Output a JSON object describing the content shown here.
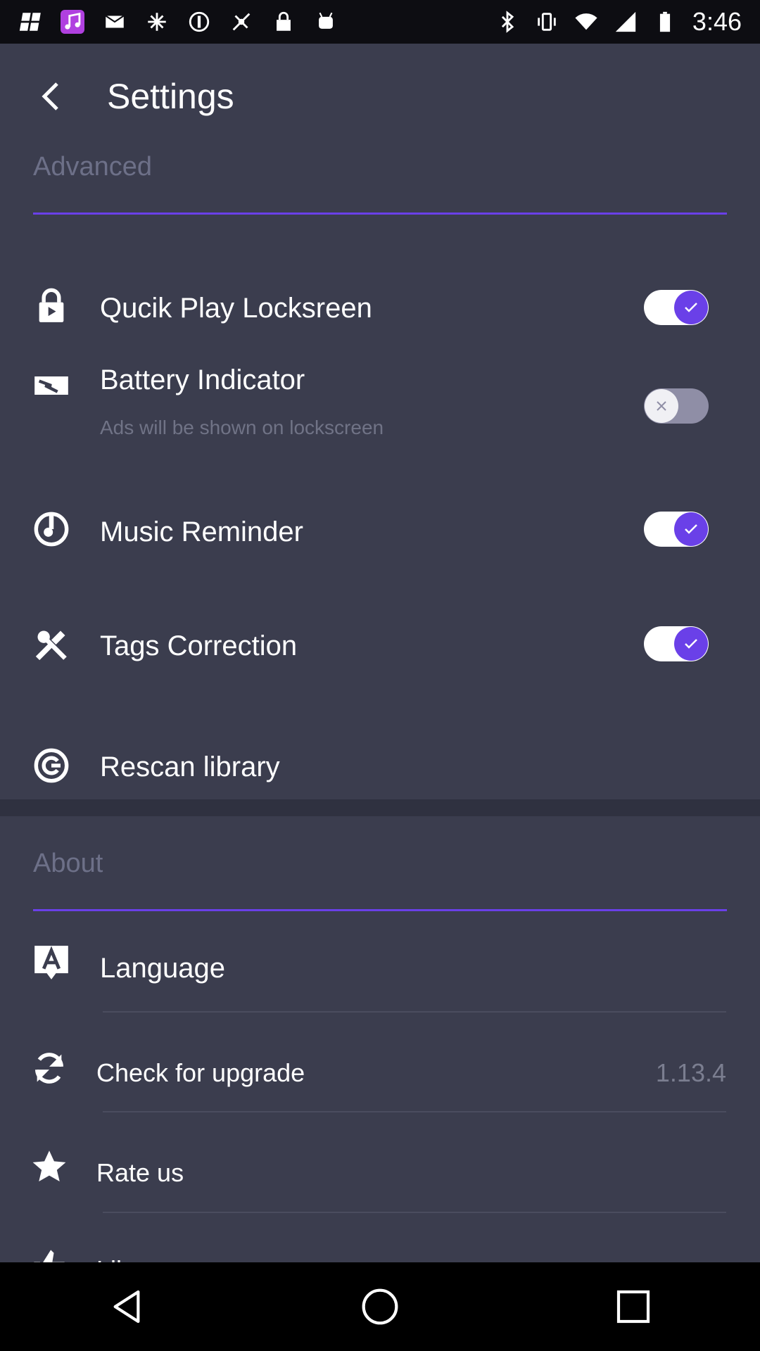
{
  "status_bar": {
    "time": "3:46",
    "left_icons": [
      "notification-icon",
      "music-app-icon",
      "mail-icon",
      "satellite-icon",
      "blocked-icon",
      "location-off-icon",
      "lock-icon",
      "android-icon"
    ],
    "right_icons": [
      "bluetooth-icon",
      "vibrate-icon",
      "wifi-icon",
      "signal-icon",
      "battery-icon"
    ]
  },
  "header": {
    "title": "Settings"
  },
  "advanced": {
    "header": "Advanced",
    "rows": [
      {
        "label": "Qucik Play Locksreen",
        "icon": "lock-icon",
        "toggle": true
      },
      {
        "label": "Battery Indicator",
        "sublabel": "Ads will be shown on lockscreen",
        "icon": "battery-indicator-icon",
        "toggle": false
      },
      {
        "label": "Music Reminder",
        "icon": "music-reminder-icon",
        "toggle": true
      },
      {
        "label": "Tags Correction",
        "icon": "tools-icon",
        "toggle": true
      },
      {
        "label": "Rescan library",
        "icon": "rescan-icon"
      }
    ]
  },
  "about": {
    "header": "About",
    "rows": [
      {
        "label": "Language",
        "icon": "language-icon"
      },
      {
        "label": "Check for upgrade",
        "value": "1.13.4",
        "icon": "refresh-icon"
      },
      {
        "label": "Rate us",
        "icon": "star-icon"
      },
      {
        "label": "Like us",
        "icon": "thumbs-up-icon"
      }
    ]
  },
  "colors": {
    "accent": "#6a40e8",
    "background": "#3b3d4e",
    "muted": "#6d7088"
  }
}
